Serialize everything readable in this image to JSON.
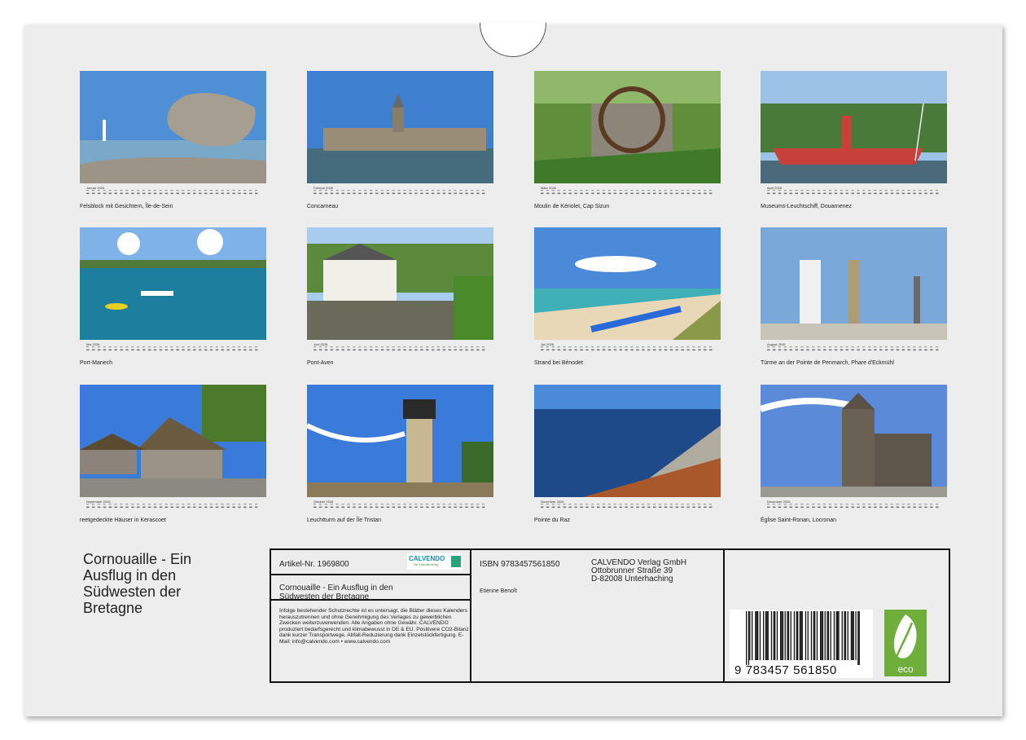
{
  "months": [
    {
      "month": "Januar 2026",
      "caption": "Felsblock mit Gesichtern, Île-de-Sein",
      "photo": "rock-lighthouse-photo"
    },
    {
      "month": "Februar 2026",
      "caption": "Concarneau",
      "photo": "fortress-harbor-photo"
    },
    {
      "month": "März 2026",
      "caption": "Moulin de Kériolet, Cap Sizun",
      "photo": "water-mill-photo"
    },
    {
      "month": "April 2026",
      "caption": "Museums-Leuchtschiff, Douarnenez",
      "photo": "lightship-photo"
    },
    {
      "month": "Mai 2026",
      "caption": "Port-Manech",
      "photo": "boats-bay-photo"
    },
    {
      "month": "Juni 2026",
      "caption": "Pont-Aven",
      "photo": "river-village-photo"
    },
    {
      "month": "Juli 2026",
      "caption": "Strand bei Bénodet",
      "photo": "beach-kayaks-photo"
    },
    {
      "month": "August 2026",
      "caption": "Türme an der Pointe de Penmarch, Phare d'Eckmühl",
      "photo": "towers-photo"
    },
    {
      "month": "September 2026",
      "caption": "reetgedeckte Häuser in Kerascoet",
      "photo": "thatched-houses-photo"
    },
    {
      "month": "Oktober 2026",
      "caption": "Leuchtturm auf der Île Tristan",
      "photo": "lighthouse-photo"
    },
    {
      "month": "November 2026",
      "caption": "Pointe du Raz",
      "photo": "cliff-coast-photo"
    },
    {
      "month": "Dezember 2026",
      "caption": "Église Saint-Ronan, Locronan",
      "photo": "church-photo"
    }
  ],
  "title": "Cornouaille - Ein Ausflug in den Südwesten der Bretagne",
  "info": {
    "article_no": "Artikel-Nr. 1969800",
    "brand": "CALVENDO",
    "brand_sub": "Der Kalenderverlag",
    "subtitle": "Cornouaille - Ein Ausflug in den Südwesten der Bretagne",
    "legal": "Infolge bestehender Schutzrechte ist es untersagt, die Blätter dieses Kalenders herauszutrennen und ohne Genehmigung des Verlages zu gewerblichen Zwecken weiterzuverwenden. Alle Angaben ohne Gewähr. CALVENDO produziert bedarfsgerecht und klimabewusst in DE & EU. Positivere CO2-Bilanz dank kurzer Transportwege. Abfall-Reduzierung dank Einzelstückfertigung. E-Mail: info@calvendo.com • www.calvendo.com",
    "isbn": "ISBN 9783457561850",
    "author": "Etienne Benoît",
    "publisher_name": "CALVENDO Verlag GmbH",
    "publisher_street": "Ottobrunner Straße 39",
    "publisher_city": "D-82008 Unterhaching",
    "barcode_digits": "9 783457 561850",
    "eco_label": "eco"
  },
  "colors": {
    "accent": "#6fae3a",
    "sky": "#3a78c8",
    "sea": "#1d7e9e",
    "stone": "#8a8a80"
  }
}
